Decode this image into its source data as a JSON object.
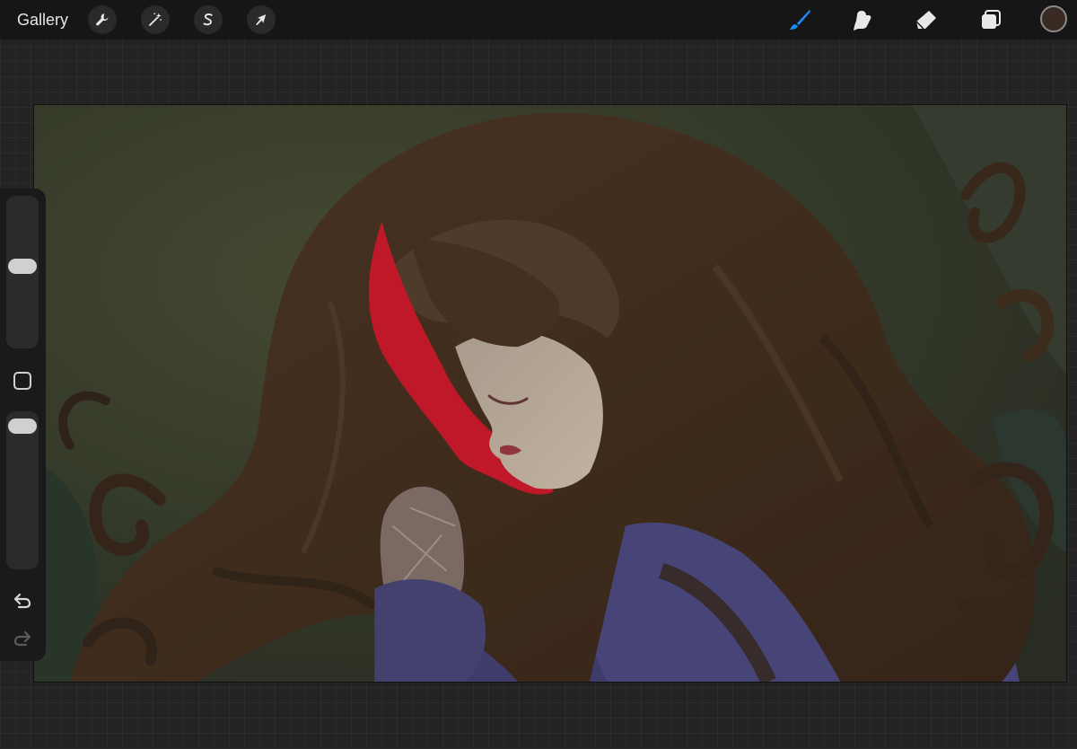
{
  "topbar": {
    "gallery_label": "Gallery",
    "left_tools": [
      {
        "name": "actions",
        "icon": "wrench-icon"
      },
      {
        "name": "adjustments",
        "icon": "magic-wand-icon"
      },
      {
        "name": "selection",
        "icon": "selection-s-icon"
      },
      {
        "name": "transform",
        "icon": "arrow-cursor-icon"
      }
    ],
    "right_tools": [
      {
        "name": "brush",
        "icon": "brush-icon",
        "active": true
      },
      {
        "name": "smudge",
        "icon": "smudge-finger-icon",
        "active": false
      },
      {
        "name": "eraser",
        "icon": "eraser-icon",
        "active": false
      },
      {
        "name": "layers",
        "icon": "layers-icon",
        "active": false
      }
    ],
    "current_color": "#3a2a24"
  },
  "sidebar": {
    "brush_size_icon": "brush-size-slider",
    "modify_icon": "modify-square-icon",
    "opacity_icon": "opacity-slider",
    "undo_icon": "undo-arrow-icon",
    "redo_icon": "redo-arrow-icon"
  },
  "colors": {
    "accent": "#1a8cff",
    "toolbar_bg": "#161616",
    "hair": "#4a3526",
    "sweater": "#4e4b83",
    "red_shadow": "#d01b2c",
    "skin": "#c9b8a6",
    "background_green": "#3b4230"
  }
}
